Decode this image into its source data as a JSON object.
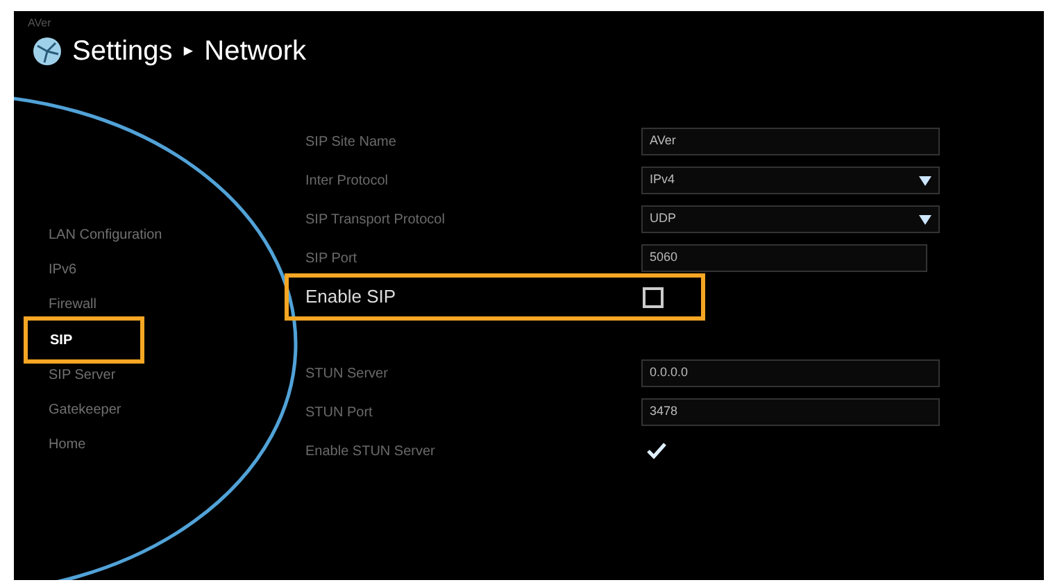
{
  "brand": "AVer",
  "breadcrumb": {
    "section": "Settings",
    "separator": "►",
    "page": "Network"
  },
  "sidebar": {
    "items": [
      {
        "label": "LAN Configuration",
        "selected": false,
        "highlighted": false
      },
      {
        "label": "IPv6",
        "selected": false,
        "highlighted": false
      },
      {
        "label": "Firewall",
        "selected": false,
        "highlighted": false
      },
      {
        "label": "SIP",
        "selected": true,
        "highlighted": true
      },
      {
        "label": "SIP Server",
        "selected": false,
        "highlighted": false
      },
      {
        "label": "Gatekeeper",
        "selected": false,
        "highlighted": false
      },
      {
        "label": "Home",
        "selected": false,
        "highlighted": false
      }
    ]
  },
  "settings": [
    {
      "kind": "text",
      "label": "SIP Site Name",
      "value": "AVer",
      "wide": true
    },
    {
      "kind": "select",
      "label": "Inter Protocol",
      "value": "IPv4"
    },
    {
      "kind": "select",
      "label": "SIP Transport Protocol",
      "value": "UDP"
    },
    {
      "kind": "text",
      "label": "SIP Port",
      "value": "5060",
      "wide": false
    },
    {
      "kind": "checkbox",
      "label": "Enable SIP",
      "checked": false,
      "highlighted": true
    },
    {
      "kind": "gap"
    },
    {
      "kind": "text",
      "label": "STUN Server",
      "value": "0.0.0.0",
      "wide": true
    },
    {
      "kind": "text",
      "label": "STUN Port",
      "value": "3478",
      "wide": true
    },
    {
      "kind": "checkbox",
      "label": "Enable STUN Server",
      "checked": true,
      "highlighted": false
    }
  ]
}
